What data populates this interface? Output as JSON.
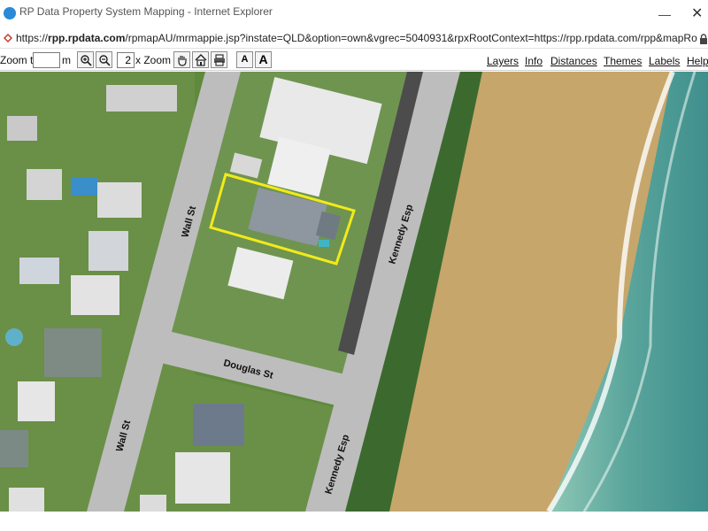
{
  "window": {
    "title": "RP Data Property System Mapping - Internet Explorer",
    "minimize_glyph": "—",
    "close_glyph": "✕"
  },
  "address_bar": {
    "protocol": "https://",
    "host": "rpp.rpdata.com",
    "path": "/rpmapAU/mrmappie.jsp?instate=QLD&option=own&vgrec=5040931&rpxRootContext=https://rpp.rpdata.com/rpp&mapRootContext=http://rp"
  },
  "toolbar": {
    "zoom_to_label": "Zoom to",
    "zoom_to_value": "",
    "unit_label": "m",
    "zoom_factor_value": "2",
    "zoom_factor_label": "x Zoom",
    "font_small_label": "A",
    "font_large_label": "A",
    "menu": [
      "Layers",
      "Info",
      "Distances",
      "Themes",
      "Labels",
      "Help"
    ],
    "icons": [
      "zoom-in-icon",
      "zoom-out-icon",
      "pan-hand-icon",
      "home-icon",
      "print-icon"
    ]
  },
  "map": {
    "streets": {
      "wall_st_upper": "Wall St",
      "wall_st_lower": "Wall St",
      "douglas_st": "Douglas St",
      "kennedy_esp_upper": "Kennedy Esp",
      "kennedy_esp_lower": "Kennedy Esp"
    },
    "highlight_color": "#f2ea1a",
    "road_color": "#bdbdbd",
    "grass_color": "#5f8a3c",
    "sand_color": "#c6a66b",
    "sea_color": "#5aa59c"
  }
}
